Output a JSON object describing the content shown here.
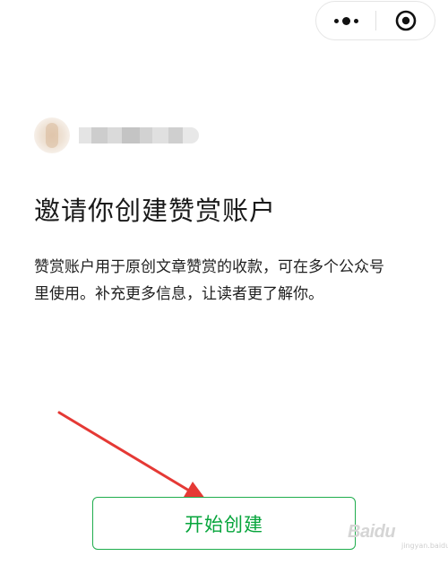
{
  "capsule": {
    "more_icon": "more-dots-icon",
    "close_icon": "target-close-icon"
  },
  "account": {
    "avatar": "avatar-image",
    "name_blurred": true
  },
  "main": {
    "title": "邀请你创建赞赏账户",
    "description_line1": "赞赏账户用于原创文章赞赏的收款，可在多个公众号",
    "description_line2": "里使用。补充更多信息，让读者更了解你。"
  },
  "actions": {
    "start_label": "开始创建"
  },
  "annotation": {
    "arrow_color": "#e53935"
  },
  "watermark": {
    "brand": "Baidu",
    "sub": "jingyan.baidu.com"
  },
  "colors": {
    "accent": "#07a53c",
    "title": "#1a1a1a",
    "text": "#1f1f1f"
  }
}
